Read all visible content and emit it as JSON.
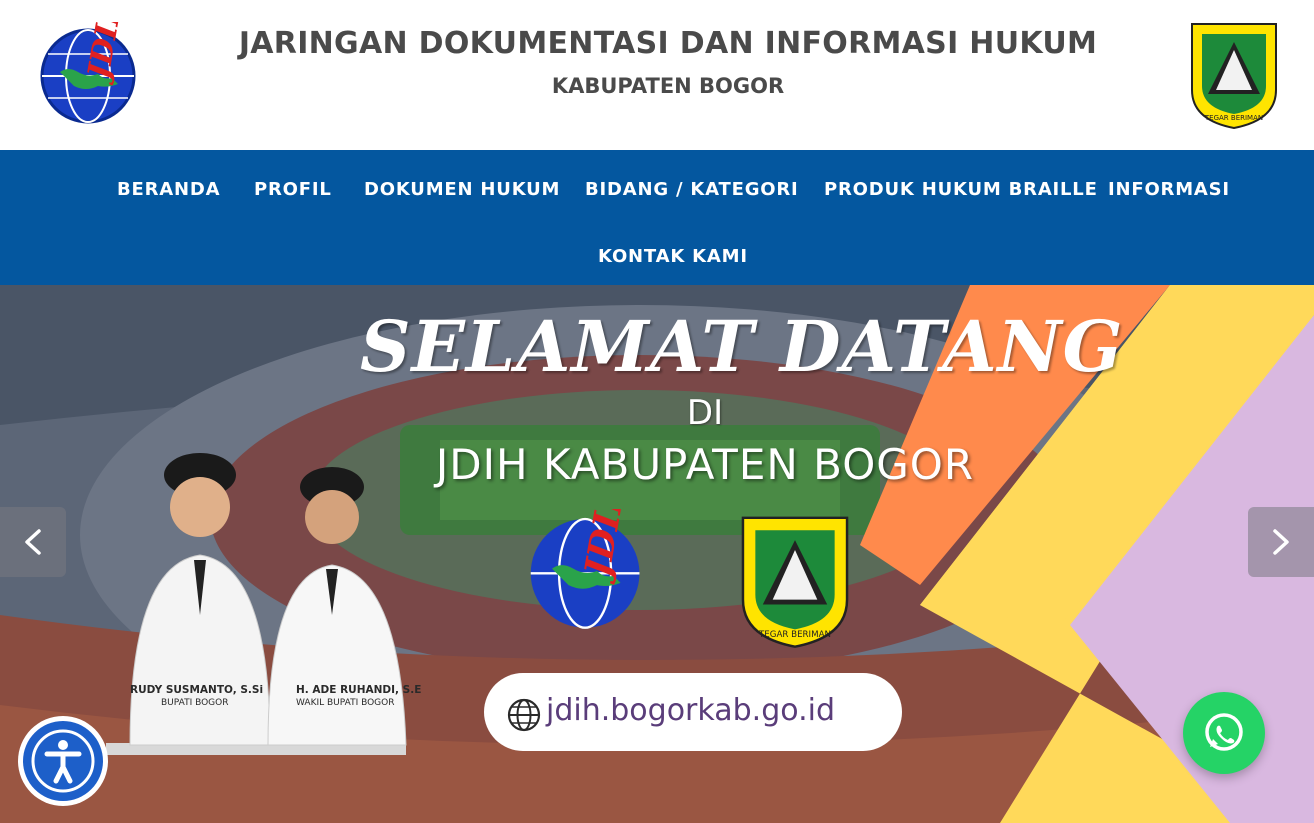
{
  "header": {
    "title": "JARINGAN DOKUMENTASI DAN INFORMASI HUKUM",
    "subtitle": "KABUPATEN BOGOR",
    "logo_left": {
      "icon": "jdih-logo",
      "text": "JDIH"
    },
    "logo_right": {
      "icon": "kabupaten-bogor-emblem",
      "text": "TEGAR BERIMAN"
    }
  },
  "nav": {
    "items": [
      {
        "label": "BERANDA"
      },
      {
        "label": "PROFIL"
      },
      {
        "label": "DOKUMEN HUKUM"
      },
      {
        "label": "BIDANG / KATEGORI"
      },
      {
        "label": "PRODUK HUKUM BRAILLE"
      },
      {
        "label": "INFORMASI"
      },
      {
        "label": "KONTAK KAMI"
      }
    ],
    "background": "#04579f"
  },
  "hero": {
    "welcome": "SELAMAT DATANG",
    "di": "DI",
    "site_name": "JDIH KABUPATEN BOGOR",
    "url": "jdih.bogorkab.go.id",
    "person1": {
      "name": "RUDY SUSMANTO, S.Si",
      "role": "BUPATI BOGOR"
    },
    "person2": {
      "name": "H. ADE RUHANDI, S.E",
      "role": "WAKIL BUPATI BOGOR"
    },
    "emblem_text": "TEGAR BERIMAN",
    "shape_colors": [
      "#ff8a4c",
      "#ffd95a",
      "#d9b8e0"
    ]
  },
  "controls": {
    "prev_icon": "chevron-left-icon",
    "next_icon": "chevron-right-icon",
    "accessibility_icon": "accessibility-icon",
    "whatsapp_icon": "whatsapp-icon"
  }
}
